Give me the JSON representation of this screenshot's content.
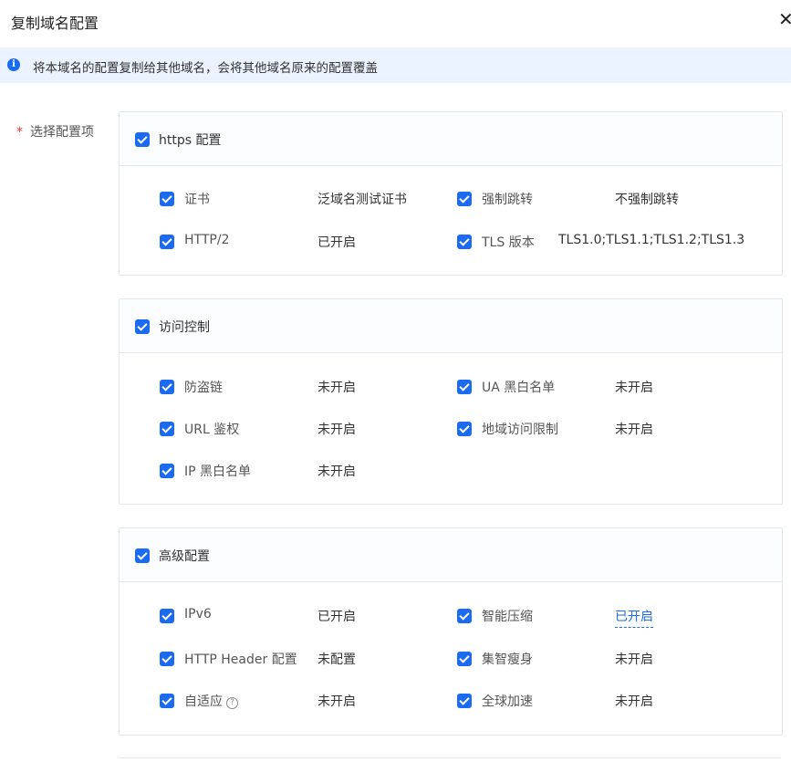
{
  "dialog": {
    "title": "复制域名配置",
    "close_symbol": "✕"
  },
  "notice": {
    "icon": "info-icon",
    "text": "将本域名的配置复制给其他域名，会将其他域名原来的配置覆盖"
  },
  "field": {
    "required_mark": "*",
    "label": "选择配置项"
  },
  "groups": {
    "https": {
      "label": "https 配置",
      "checked": true,
      "items": [
        {
          "label": "证书",
          "value": "泛域名测试证书",
          "checked": true
        },
        {
          "label": "强制跳转",
          "value": "不强制跳转",
          "checked": true
        },
        {
          "label": "HTTP/2",
          "value": "已开启",
          "checked": true
        },
        {
          "label": "TLS 版本",
          "value": "TLS1.0;TLS1.1;TLS1.2;TLS1.3",
          "checked": true
        }
      ]
    },
    "access": {
      "label": "访问控制",
      "checked": true,
      "items": [
        {
          "label": "防盗链",
          "value": "未开启",
          "checked": true
        },
        {
          "label": "UA 黑白名单",
          "value": "未开启",
          "checked": true
        },
        {
          "label": "URL 鉴权",
          "value": "未开启",
          "checked": true
        },
        {
          "label": "地域访问限制",
          "value": "未开启",
          "checked": true
        },
        {
          "label": "IP 黑白名单",
          "value": "未开启",
          "checked": true
        }
      ]
    },
    "advanced": {
      "label": "高级配置",
      "checked": true,
      "items": [
        {
          "label": "IPv6",
          "value": "已开启",
          "checked": true
        },
        {
          "label": "智能压缩",
          "value": "已开启",
          "checked": true
        },
        {
          "label": "HTTP Header 配置",
          "value": "未配置",
          "checked": true
        },
        {
          "label": "集智瘦身",
          "value": "未开启",
          "checked": true
        },
        {
          "label": "自适应",
          "value": "未开启",
          "checked": true,
          "help_icon": "?"
        },
        {
          "label": "全球加速",
          "value": "未开启",
          "checked": true
        }
      ]
    }
  },
  "colors": {
    "accent": "#1a6af2",
    "notice_bg": "#eaf3ff",
    "required": "#e63b3b",
    "border": "#e4e7ec"
  }
}
